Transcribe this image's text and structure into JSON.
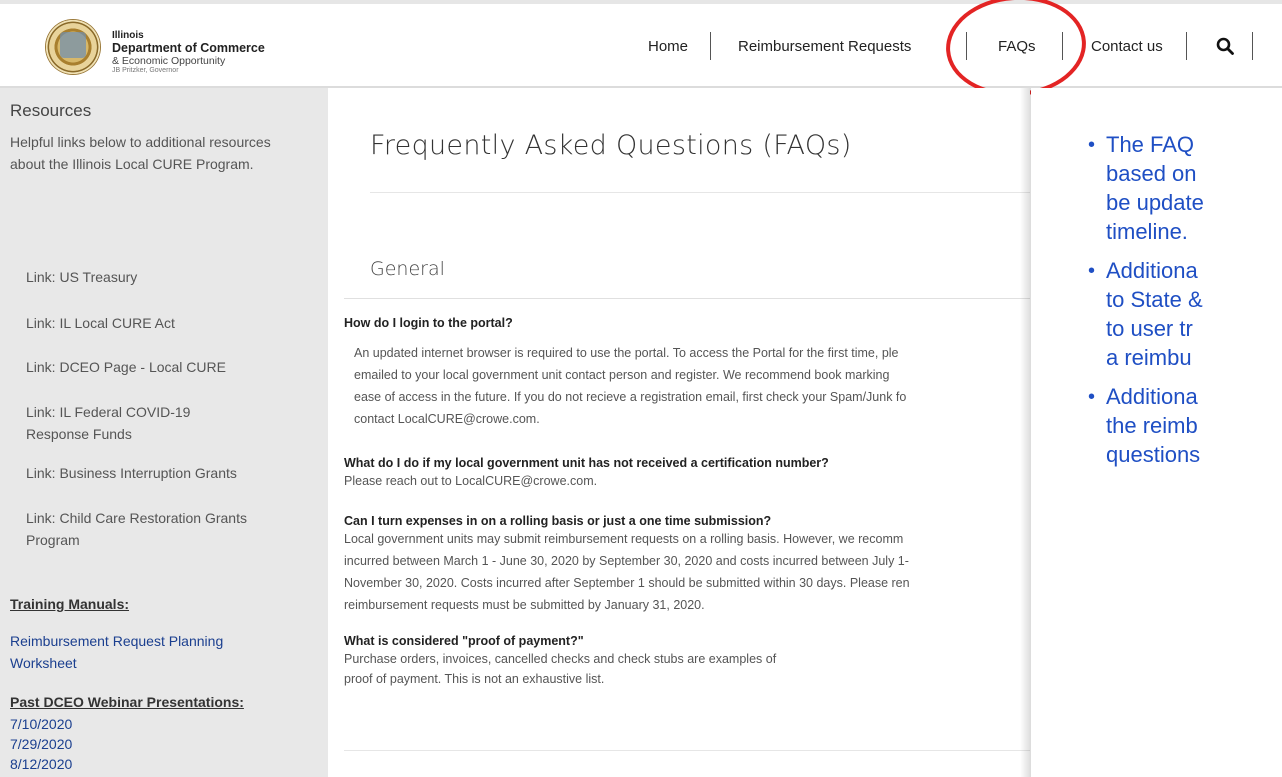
{
  "header": {
    "brand": {
      "line1": "Illinois",
      "line2": "Department of Commerce",
      "line3": "& Economic Opportunity",
      "line4": "JB Pritzker, Governor"
    },
    "nav": {
      "home": "Home",
      "reimbursement": "Reimbursement Requests",
      "faqs": "FAQs",
      "contact": "Contact us"
    }
  },
  "sidebar": {
    "title": "Resources",
    "description": "Helpful links below to additional resources about the Illinois Local CURE Program.",
    "links": [
      "Link: US Treasury",
      "Link: IL Local CURE Act",
      "Link: DCEO Page - Local CURE",
      "Link: IL Federal COVID-19 Response Funds",
      "Link: Business Interruption Grants",
      "Link: Child Care Restoration Grants Program"
    ],
    "training_title": "Training Manuals:",
    "training_link": "Reimbursement Request Planning Worksheet",
    "webinars_title": "Past DCEO Webinar Presentations:",
    "webinars": [
      "7/10/2020",
      "7/29/2020",
      "8/12/2020"
    ]
  },
  "main": {
    "title": "Frequently Asked Questions (FAQs)",
    "section": "General",
    "faqs": [
      {
        "q": "How do I login to the portal?",
        "a": [
          "An updated internet browser is required to use the portal. To access the Portal for the first time, ple",
          "emailed to your local government unit contact person and register. We recommend book marking",
          "ease of access in the future. If you do not recieve a registration email, first check your Spam/Junk fo",
          "contact LocalCURE@crowe.com."
        ]
      },
      {
        "q": "What do I do if my local government unit has not received a certification number?",
        "a": [
          "Please reach out to LocalCURE@crowe.com."
        ]
      },
      {
        "q": "Can I turn expenses in on a rolling basis or just a one time submission?",
        "a": [
          "Local government units may submit reimbursement requests on a rolling basis. However, we recomm",
          "incurred between March 1 - June 30, 2020 by September 30, 2020 and costs incurred between July 1-",
          "November 30, 2020. Costs incurred after September 1 should be submitted within 30 days. Please ren",
          "reimbursement requests must be submitted by January 31, 2020."
        ]
      },
      {
        "q": "What is considered \"proof of payment?\"",
        "a": [
          "Purchase orders, invoices, cancelled checks and check stubs are examples of",
          "proof of payment. This is not an exhaustive list."
        ]
      }
    ]
  },
  "overlay": {
    "bullet_char": "•",
    "bullets": [
      [
        "The FAQ",
        "based on",
        "be update",
        "timeline."
      ],
      [
        "Additiona",
        "to State &",
        "to user tr",
        "a reimbu"
      ],
      [
        "Additiona",
        "the reimb",
        "questions"
      ]
    ],
    "text_color": "#1f4fc4",
    "highlight_color": "#e32424"
  }
}
